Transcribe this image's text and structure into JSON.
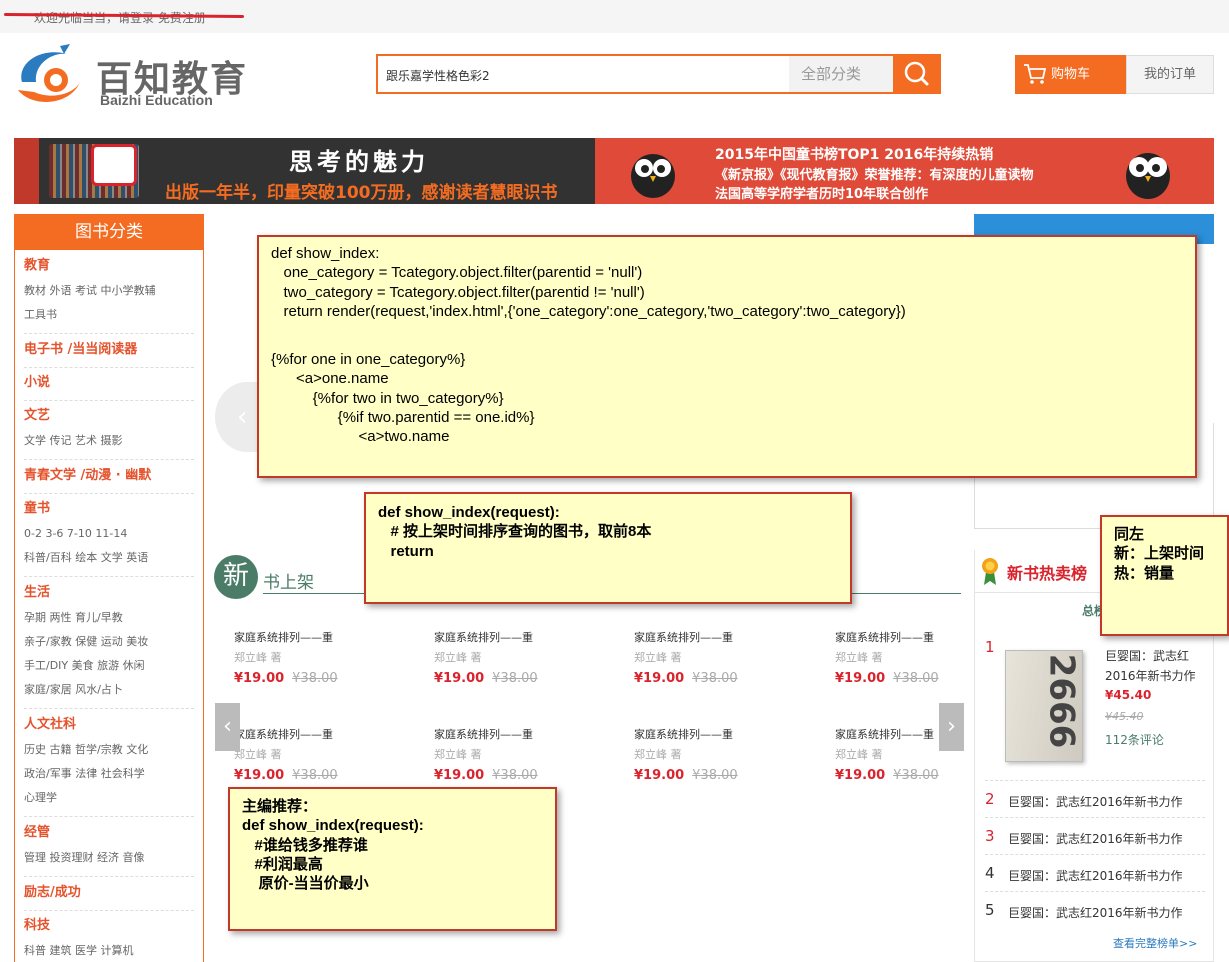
{
  "topbar": {
    "welcome": "欢迎光临当当，请登录 免费注册"
  },
  "logo": {
    "name": "百知教育",
    "english": "Baizhi Education"
  },
  "search": {
    "query": "跟乐嘉学性格色彩2",
    "category": "全部分类"
  },
  "header": {
    "cart": "购物车",
    "orders": "我的订单"
  },
  "banner": {
    "left_title": "思考的魅力",
    "left_sub": "出版一年半，印量突破100万册，感谢读者慧眼识书",
    "right_line1": "2015年中国童书榜TOP1   2016年持续热销",
    "right_line2": "《新京报》《现代教育报》荣誉推荐：有深度的儿童读物",
    "right_line3": "法国高等学府学者历时10年联合创作"
  },
  "sidebar": {
    "title": "图书分类",
    "sections": [
      {
        "title": "教育",
        "lines": [
          "教材  外语  考试  中小学教辅",
          "工具书"
        ]
      },
      {
        "title": "电子书 /当当阅读器",
        "lines": []
      },
      {
        "title": "小说",
        "lines": []
      },
      {
        "title": "文艺",
        "lines": [
          "文学  传记  艺术  摄影"
        ]
      },
      {
        "title": "青春文学 /动漫 · 幽默",
        "lines": []
      },
      {
        "title": "童书",
        "lines": [
          "0-2  3-6  7-10  11-14",
          "科普/百科  绘本  文学  英语"
        ]
      },
      {
        "title": "生活",
        "lines": [
          "孕期  两性  育儿/早教",
          "亲子/家教  保健  运动  美妆",
          "手工/DIY  美食  旅游  休闲",
          "家庭/家居  风水/占卜"
        ]
      },
      {
        "title": "人文社科",
        "lines": [
          "历史  古籍  哲学/宗教  文化",
          "政治/军事  法律  社会科学",
          "心理学"
        ]
      },
      {
        "title": "经管",
        "lines": [
          "管理  投资理财  经济  音像"
        ]
      },
      {
        "title": "励志/成功",
        "lines": []
      },
      {
        "title": "科技",
        "lines": [
          "科普  建筑  医学  计算机"
        ]
      }
    ]
  },
  "new_books": {
    "badge": "新",
    "title": "书上架",
    "items": [
      {
        "title": "家庭系统排列——重",
        "author": "郑立峰 著",
        "price": "¥19.00",
        "old_price": "¥38.00"
      },
      {
        "title": "家庭系统排列——重",
        "author": "郑立峰 著",
        "price": "¥19.00",
        "old_price": "¥38.00"
      },
      {
        "title": "家庭系统排列——重",
        "author": "郑立峰 著",
        "price": "¥19.00",
        "old_price": "¥38.00"
      },
      {
        "title": "家庭系统排列——重",
        "author": "郑立峰 著",
        "price": "¥19.00",
        "old_price": "¥38.00"
      },
      {
        "title": "家庭系统排列——重",
        "author": "郑立峰 著",
        "price": "¥19.00",
        "old_price": "¥38.00"
      },
      {
        "title": "家庭系统排列——重",
        "author": "郑立峰 著",
        "price": "¥19.00",
        "old_price": "¥38.00"
      },
      {
        "title": "家庭系统排列——重",
        "author": "郑立峰 著",
        "price": "¥19.00",
        "old_price": "¥38.00"
      },
      {
        "title": "家庭系统排列——重",
        "author": "郑立峰 著",
        "price": "¥19.00",
        "old_price": "¥38.00"
      }
    ]
  },
  "ranking": {
    "title": "新书热卖榜",
    "tab": "总榜",
    "top": {
      "rank": "1",
      "title": "巨婴国：武志红2016年新书力作",
      "cover_text": "2666",
      "price": "¥45.40",
      "old_price": "¥45.40",
      "reviews": "112条评论"
    },
    "items": [
      {
        "rank": "2",
        "title": "巨婴国：武志红2016年新书力作"
      },
      {
        "rank": "3",
        "title": "巨婴国：武志红2016年新书力作"
      },
      {
        "rank": "4",
        "title": "巨婴国：武志红2016年新书力作"
      },
      {
        "rank": "5",
        "title": "巨婴国：武志红2016年新书力作"
      }
    ],
    "more": "查看完整榜单>>"
  },
  "notes": {
    "note1": [
      "def show_index:",
      "   one_category = Tcategory.object.filter(parentid = 'null')",
      "   two_category = Tcategory.object.filter(parentid != 'null')",
      "   return render(request,'index.html',{'one_category':one_category,'two_category':two_category})",
      "",
      "{%for one in one_category%}",
      "      <a>one.name",
      "          {%for two in two_category%}",
      "                {%if two.parentid == one.id%}",
      "                     <a>two.name"
    ],
    "note2": [
      "def show_index(request):",
      "   # 按上架时间排序查询的图书，取前8本",
      "   return"
    ],
    "note3": [
      "同左",
      "新：上架时间",
      "热：销量"
    ],
    "note4": [
      "主编推荐：",
      "def show_index(request):",
      "   #谁给钱多推荐谁",
      "   #利润最高",
      "    原价-当当价最小"
    ]
  },
  "colors": {
    "accent": "#f36c21",
    "brand_red": "#d9232d",
    "green": "#4a7c68",
    "note_bg": "#ffffc6"
  }
}
